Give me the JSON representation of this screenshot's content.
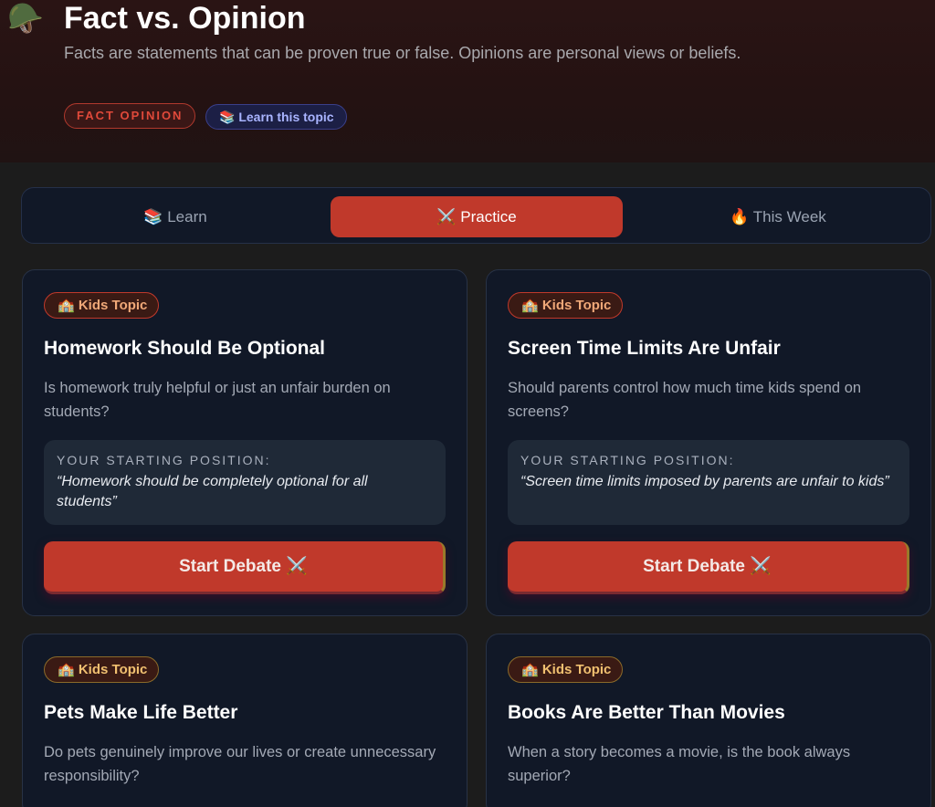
{
  "header": {
    "icon": "helmet-icon",
    "title": "Fact vs. Opinion",
    "subtitle": "Facts are statements that can be proven true or false. Opinions are personal views or beliefs.",
    "tag": "FACT OPINION",
    "learn_link": "📚 Learn this topic"
  },
  "tabs": [
    {
      "label": "📚 Learn",
      "active": false
    },
    {
      "label": "⚔️ Practice",
      "active": true
    },
    {
      "label": "🔥 This Week",
      "active": false
    }
  ],
  "cards": [
    {
      "badge": "🏫 Kids Topic",
      "title": "Homework Should Be Optional",
      "description": "Is homework truly helpful or just an unfair burden on students?",
      "position_label": "YOUR STARTING POSITION:",
      "position": "“Homework should be completely optional for all students”",
      "button": "Start Debate ⚔️"
    },
    {
      "badge": "🏫 Kids Topic",
      "title": "Screen Time Limits Are Unfair",
      "description": "Should parents control how much time kids spend on screens?",
      "position_label": "YOUR STARTING POSITION:",
      "position": "“Screen time limits imposed by parents are unfair to kids”",
      "button": "Start Debate ⚔️"
    },
    {
      "badge": "🏫 Kids Topic",
      "title": "Pets Make Life Better",
      "description": "Do pets genuinely improve our lives or create unnecessary responsibility?"
    },
    {
      "badge": "🏫 Kids Topic",
      "title": "Books Are Better Than Movies",
      "description": "When a story becomes a movie, is the book always superior?"
    }
  ],
  "colors": {
    "accent": "#c0392b",
    "card_bg": "#111827",
    "page_bg": "#1c1c1c"
  }
}
